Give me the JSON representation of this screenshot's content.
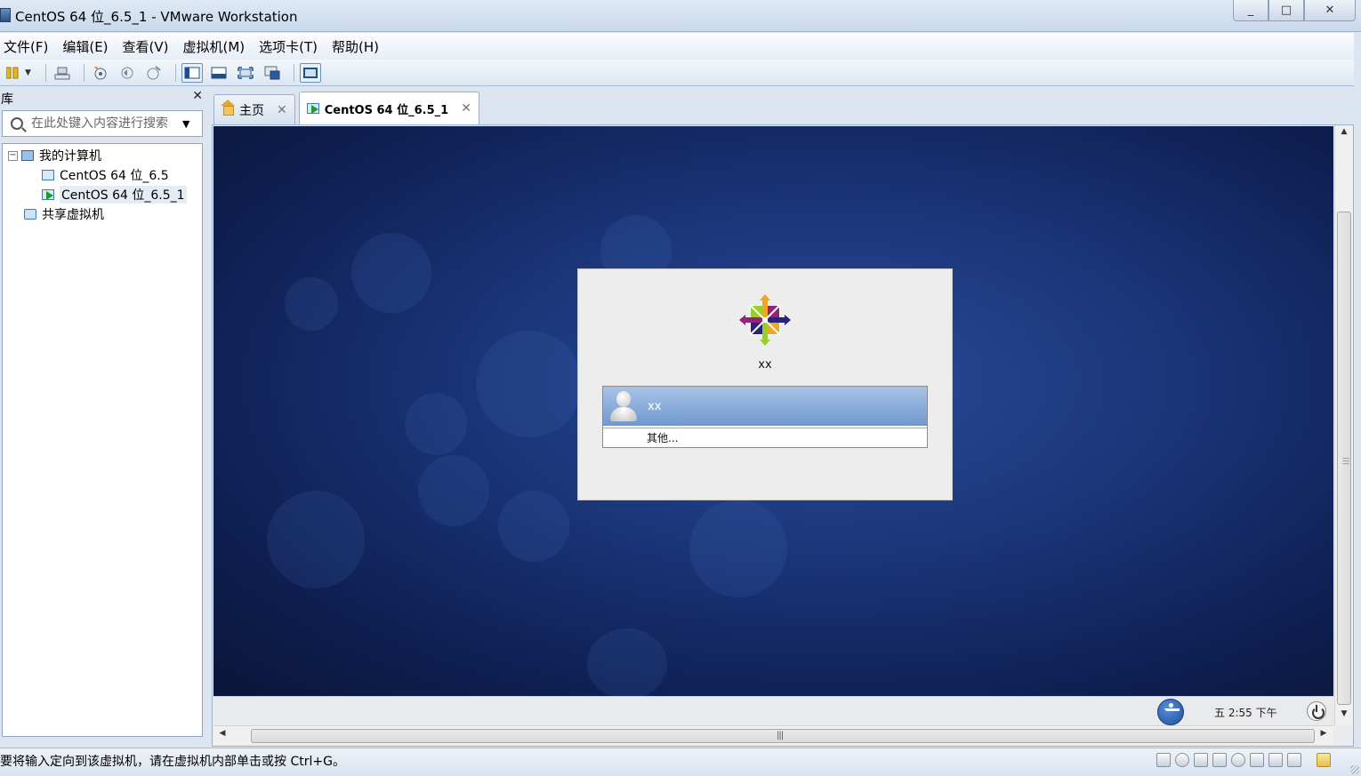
{
  "window": {
    "title": "CentOS 64 位_6.5_1 - VMware Workstation",
    "controls": {
      "minimize": "▭",
      "maximize": "□",
      "close": "✕"
    }
  },
  "menu": {
    "items": [
      "文件(F)",
      "编辑(E)",
      "查看(V)",
      "虚拟机(M)",
      "选项卡(T)",
      "帮助(H)"
    ]
  },
  "toolbar": {
    "icons": [
      "pause-icon",
      "send-ctrl-alt-del-icon",
      "snapshot-icon",
      "revert-snapshot-icon",
      "snapshot-manager-icon",
      "show-library-icon",
      "thumbnail-bar-icon",
      "fullscreen-icon",
      "unity-icon",
      "console-view-icon"
    ]
  },
  "library": {
    "title": "库",
    "close": "✕",
    "search_placeholder": "在此处键入内容进行搜索",
    "tree": {
      "root_label": "我的计算机",
      "root_toggle": "−",
      "vms": [
        "CentOS 64 位_6.5",
        "CentOS 64 位_6.5_1"
      ],
      "selected_vm": "CentOS 64 位_6.5_1",
      "shared_label": "共享虚拟机"
    }
  },
  "tabs": [
    {
      "label": "主页",
      "close": "✕",
      "icon": "home-icon"
    },
    {
      "label": "CentOS 64 位_6.5_1",
      "close": "✕",
      "icon": "vm-running-icon",
      "active": true
    }
  ],
  "vm": {
    "login": {
      "hostname": "xx",
      "users": [
        {
          "name": "xx",
          "selected": true
        }
      ],
      "other_label": "其他..."
    },
    "panel": {
      "clock": "五  2:55 下午"
    }
  },
  "statusbar": {
    "message": "要将输入定向到该虚拟机，请在虚拟机内部单击或按 Ctrl+G。",
    "device_icons": [
      "hard-disk-icon",
      "cd-dvd-icon",
      "network-icon",
      "printer-icon",
      "sound-icon",
      "usb-icon",
      "display-icon",
      "removable-device-icon"
    ]
  },
  "colors": {
    "desktop_blue": "#1b3578",
    "selected_user_row": "#6f98d0",
    "chrome": "#dde6f0"
  }
}
